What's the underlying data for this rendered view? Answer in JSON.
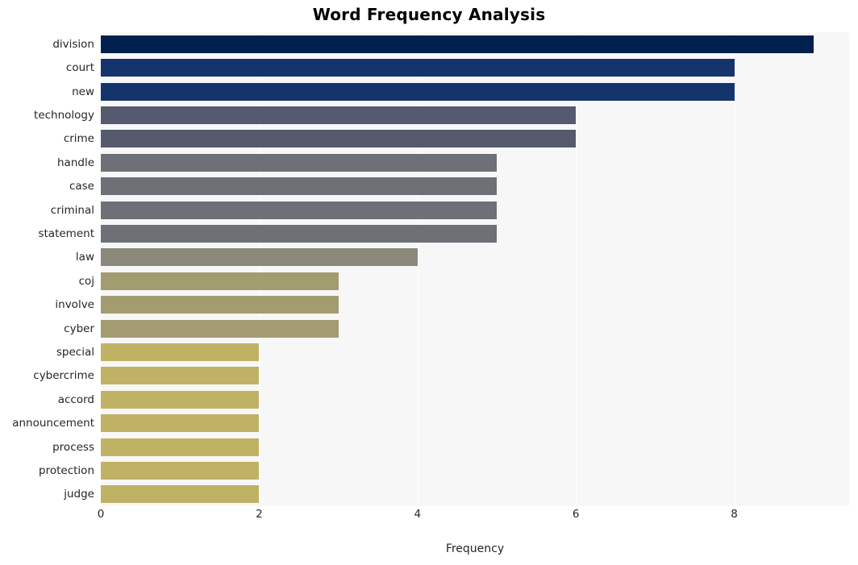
{
  "chart_data": {
    "type": "bar",
    "orientation": "horizontal",
    "title": "Word Frequency Analysis",
    "xlabel": "Frequency",
    "ylabel": "",
    "xlim": [
      0,
      9.45
    ],
    "xticks": [
      0,
      2,
      4,
      6,
      8
    ],
    "xtick_labels": [
      "0",
      "2",
      "4",
      "6",
      "8"
    ],
    "grid": "vertical-only",
    "legend": "none",
    "background": "#f7f7f8",
    "categories": [
      "division",
      "court",
      "new",
      "technology",
      "crime",
      "handle",
      "case",
      "criminal",
      "statement",
      "law",
      "coj",
      "involve",
      "cyber",
      "special",
      "cybercrime",
      "accord",
      "announcement",
      "process",
      "protection",
      "judge"
    ],
    "values": [
      9,
      8,
      8,
      6,
      6,
      5,
      5,
      5,
      5,
      4,
      3,
      3,
      3,
      2,
      2,
      2,
      2,
      2,
      2,
      2
    ],
    "bar_colors": [
      "#00214d",
      "#16346c",
      "#16346c",
      "#565a6e",
      "#565a6e",
      "#6e7077",
      "#6e7077",
      "#6e7077",
      "#6e7077",
      "#8a8878",
      "#a39c70",
      "#a39c70",
      "#a39c70",
      "#bfb264",
      "#bfb264",
      "#bfb264",
      "#bfb264",
      "#bfb264",
      "#bfb264",
      "#bfb264"
    ]
  }
}
